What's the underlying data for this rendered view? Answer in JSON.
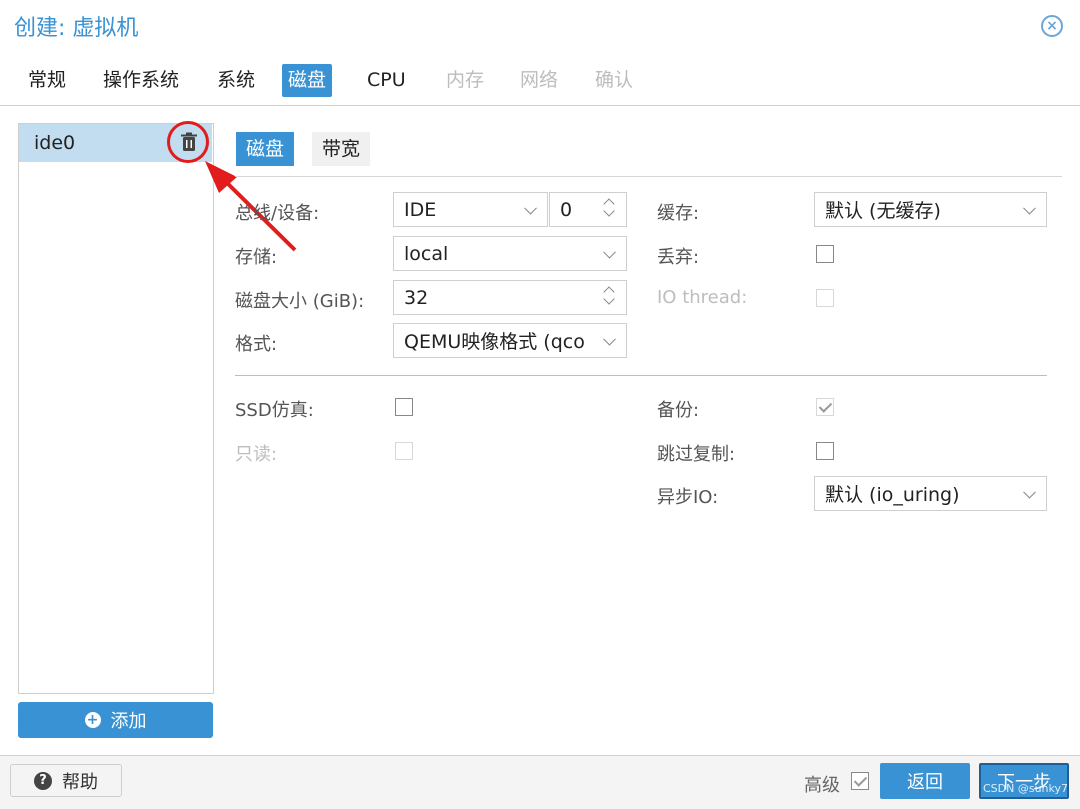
{
  "window": {
    "title": "创建: 虚拟机",
    "close_icon": "close-circle-icon"
  },
  "tabs": [
    {
      "label": "常规",
      "state": "normal"
    },
    {
      "label": "操作系统",
      "state": "normal"
    },
    {
      "label": "系统",
      "state": "normal"
    },
    {
      "label": "磁盘",
      "state": "active"
    },
    {
      "label": "CPU",
      "state": "normal"
    },
    {
      "label": "内存",
      "state": "disabled"
    },
    {
      "label": "网络",
      "state": "disabled"
    },
    {
      "label": "确认",
      "state": "disabled"
    }
  ],
  "disk_list": {
    "items": [
      {
        "label": "ide0",
        "selected": true
      }
    ],
    "delete_icon": "trash-icon",
    "add_label": "添加"
  },
  "subtabs": [
    {
      "label": "磁盘",
      "active": true
    },
    {
      "label": "带宽",
      "active": false
    }
  ],
  "form": {
    "bus_device": {
      "label": "总线/设备:",
      "bus": "IDE",
      "device": "0"
    },
    "storage": {
      "label": "存储:",
      "value": "local"
    },
    "disk_size": {
      "label": "磁盘大小 (GiB):",
      "value": "32"
    },
    "format": {
      "label": "格式:",
      "value": "QEMU映像格式 (qco"
    },
    "cache": {
      "label": "缓存:",
      "value": "默认 (无缓存)"
    },
    "discard": {
      "label": "丢弃:",
      "checked": false
    },
    "io_thread": {
      "label": "IO thread:",
      "checked": false,
      "disabled": true
    },
    "ssd_emulation": {
      "label": "SSD仿真:",
      "checked": false
    },
    "read_only": {
      "label": "只读:",
      "checked": false,
      "disabled": true
    },
    "backup": {
      "label": "备份:",
      "checked": true,
      "disabled": true
    },
    "skip_replication": {
      "label": "跳过复制:",
      "checked": false
    },
    "async_io": {
      "label": "异步IO:",
      "value": "默认 (io_uring)"
    }
  },
  "footer": {
    "help_label": "帮助",
    "advanced_label": "高级",
    "advanced_checked": true,
    "back_label": "返回",
    "next_label": "下一步"
  },
  "watermark": "CSDN @sunky7",
  "colors": {
    "accent": "#3892d4",
    "selected_row": "#c2dcf0",
    "annotation_red": "#e21c1c"
  }
}
